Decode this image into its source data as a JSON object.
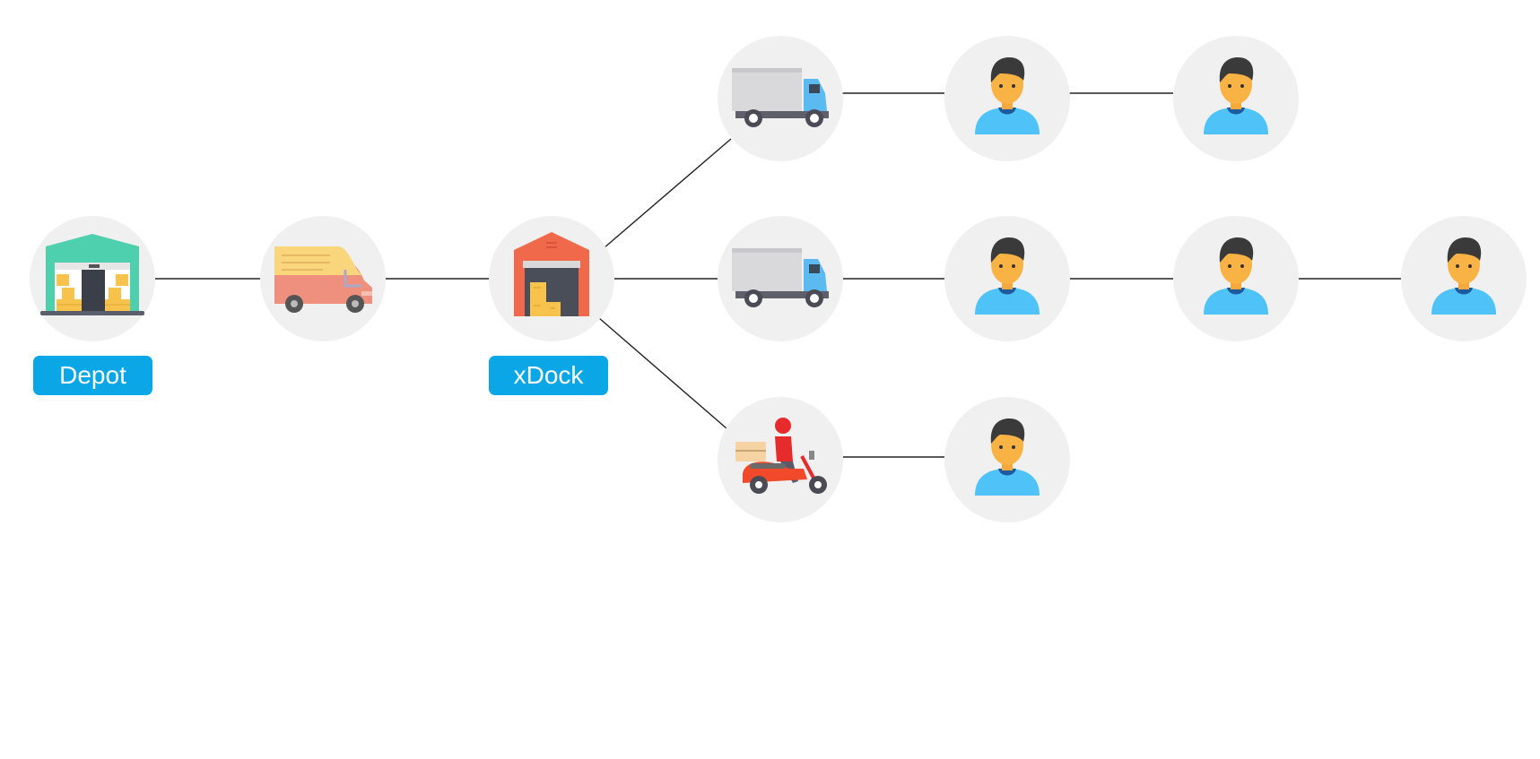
{
  "colors": {
    "label_bg": "#0aa6e6",
    "node_bg": "#f0f0f0",
    "line": "#222222"
  },
  "labels": {
    "depot": "Depot",
    "xdock": "xDock"
  },
  "nodes": [
    {
      "id": "depot",
      "icon": "warehouse-icon"
    },
    {
      "id": "van",
      "icon": "delivery-van-icon"
    },
    {
      "id": "xdock",
      "icon": "cross-dock-warehouse-icon"
    },
    {
      "id": "truck-1",
      "icon": "box-truck-icon"
    },
    {
      "id": "truck-2",
      "icon": "box-truck-icon"
    },
    {
      "id": "scooter",
      "icon": "courier-scooter-icon"
    },
    {
      "id": "customer-1a",
      "icon": "customer-icon"
    },
    {
      "id": "customer-1b",
      "icon": "customer-icon"
    },
    {
      "id": "customer-2a",
      "icon": "customer-icon"
    },
    {
      "id": "customer-2b",
      "icon": "customer-icon"
    },
    {
      "id": "customer-2c",
      "icon": "customer-icon"
    },
    {
      "id": "customer-3a",
      "icon": "customer-icon"
    }
  ],
  "edges": [
    [
      "depot",
      "van"
    ],
    [
      "van",
      "xdock"
    ],
    [
      "xdock",
      "truck-1"
    ],
    [
      "xdock",
      "truck-2"
    ],
    [
      "xdock",
      "scooter"
    ],
    [
      "truck-1",
      "customer-1a"
    ],
    [
      "customer-1a",
      "customer-1b"
    ],
    [
      "truck-2",
      "customer-2a"
    ],
    [
      "customer-2a",
      "customer-2b"
    ],
    [
      "customer-2b",
      "customer-2c"
    ],
    [
      "scooter",
      "customer-3a"
    ]
  ]
}
